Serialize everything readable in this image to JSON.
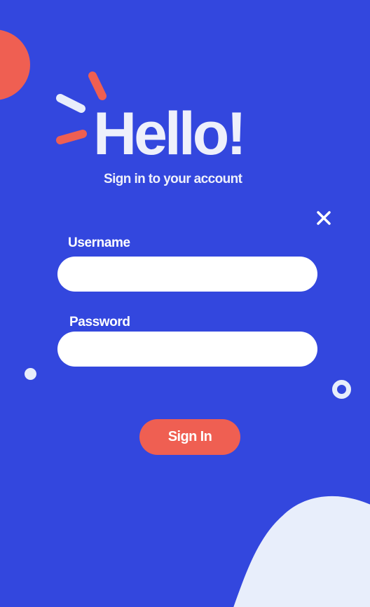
{
  "colors": {
    "background": "#3347de",
    "accent": "#ef5f52",
    "light": "#e8eefb",
    "field_background": "#ffffff"
  },
  "header": {
    "title": "Hello!",
    "subtitle": "Sign in to your account"
  },
  "icons": {
    "close": "close-icon",
    "sparkle": "sparkle-lines-icon"
  },
  "form": {
    "username_label": "Username",
    "username_value": "",
    "password_label": "Password",
    "password_value": "",
    "submit_label": "Sign In"
  }
}
